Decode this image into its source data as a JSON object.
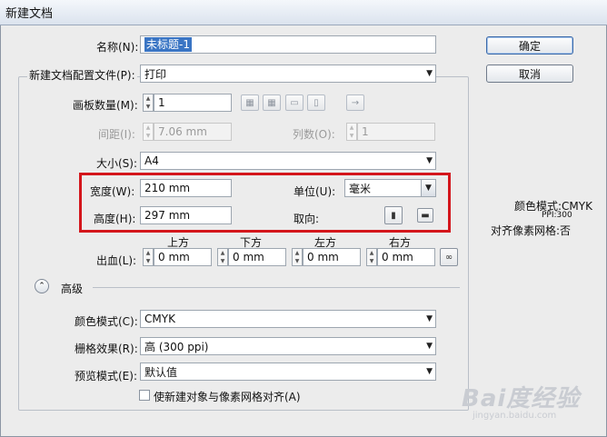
{
  "window": {
    "title": "新建文档"
  },
  "buttons": {
    "ok": "确定",
    "cancel": "取消"
  },
  "name": {
    "label": "名称(N):",
    "value": "未标题-1"
  },
  "profile": {
    "label": "新建文档配置文件(P):",
    "value": "打印"
  },
  "artboards": {
    "label": "画板数量(M):",
    "value": "1"
  },
  "spacing": {
    "label": "间距(I):",
    "value": "7.06 mm"
  },
  "columns": {
    "label": "列数(O):",
    "value": "1"
  },
  "size": {
    "label": "大小(S):",
    "value": "A4"
  },
  "width": {
    "label": "宽度(W):",
    "value": "210 mm"
  },
  "height": {
    "label": "高度(H):",
    "value": "297 mm"
  },
  "units": {
    "label": "单位(U):",
    "value": "毫米"
  },
  "orientation": {
    "label": "取向:"
  },
  "bleed": {
    "label": "出血(L):",
    "top": {
      "label": "上方",
      "value": "0 mm"
    },
    "bottom": {
      "label": "下方",
      "value": "0 mm"
    },
    "left": {
      "label": "左方",
      "value": "0 mm"
    },
    "right": {
      "label": "右方",
      "value": "0 mm"
    }
  },
  "advanced": {
    "label": "高级",
    "color_mode": {
      "label": "颜色模式(C):",
      "value": "CMYK"
    },
    "raster": {
      "label": "栅格效果(R):",
      "value": "高 (300 ppi)"
    },
    "preview": {
      "label": "预览模式(E):",
      "value": "默认值"
    },
    "align_checkbox": {
      "label": "使新建对象与像素网格对齐(A)"
    }
  },
  "info": {
    "color_mode": "颜色模式:CMYK",
    "ppi": "PPI:300",
    "pixel_grid": "对齐像素网格:否"
  },
  "watermark": {
    "text": "Bai度经验",
    "sub": "jingyan.baidu.com"
  }
}
